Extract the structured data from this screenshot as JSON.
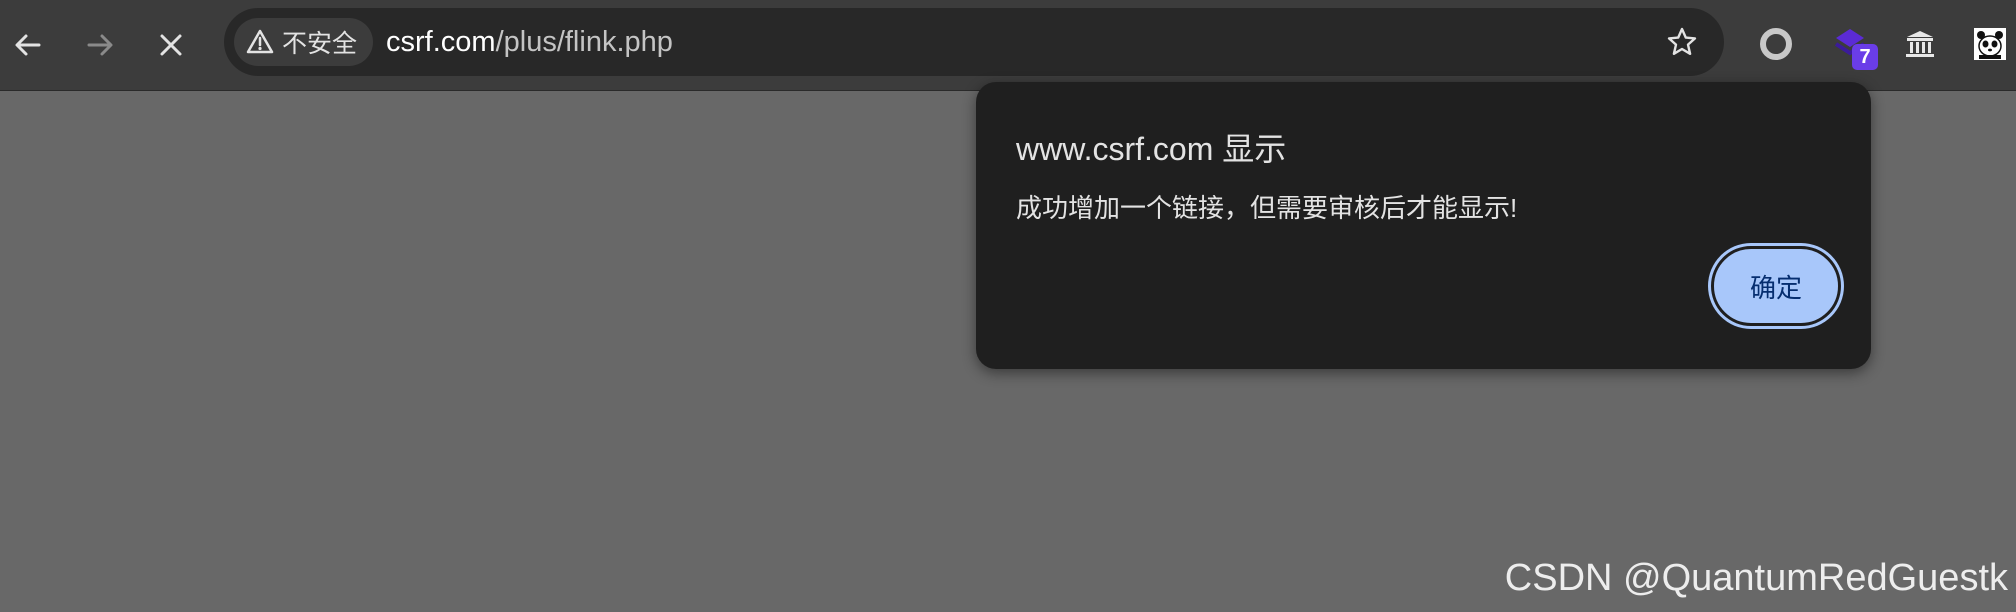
{
  "browser": {
    "security_label": "不安全",
    "url_host": "csrf.com",
    "url_path": "/plus/flink.php",
    "extension_badge": "7",
    "colors": {
      "toolbar": "#3c3c3c",
      "omnibox": "#282828",
      "page": "#686868"
    }
  },
  "dialog": {
    "title": "www.csrf.com 显示",
    "message": "成功增加一个链接，但需要审核后才能显示!",
    "ok_label": "确定",
    "colors": {
      "background": "#1f1f1f",
      "button": "#a8c7fa",
      "button_text": "#062e6f"
    }
  },
  "watermark": "CSDN @QuantumRedGuestk",
  "icons": [
    "back-arrow-icon",
    "forward-arrow-icon",
    "stop-loading-icon",
    "warning-triangle-icon",
    "bookmark-star-icon",
    "circle-extension-icon",
    "purple-extension-icon",
    "pillar-extension-icon",
    "panda-extension-icon"
  ]
}
